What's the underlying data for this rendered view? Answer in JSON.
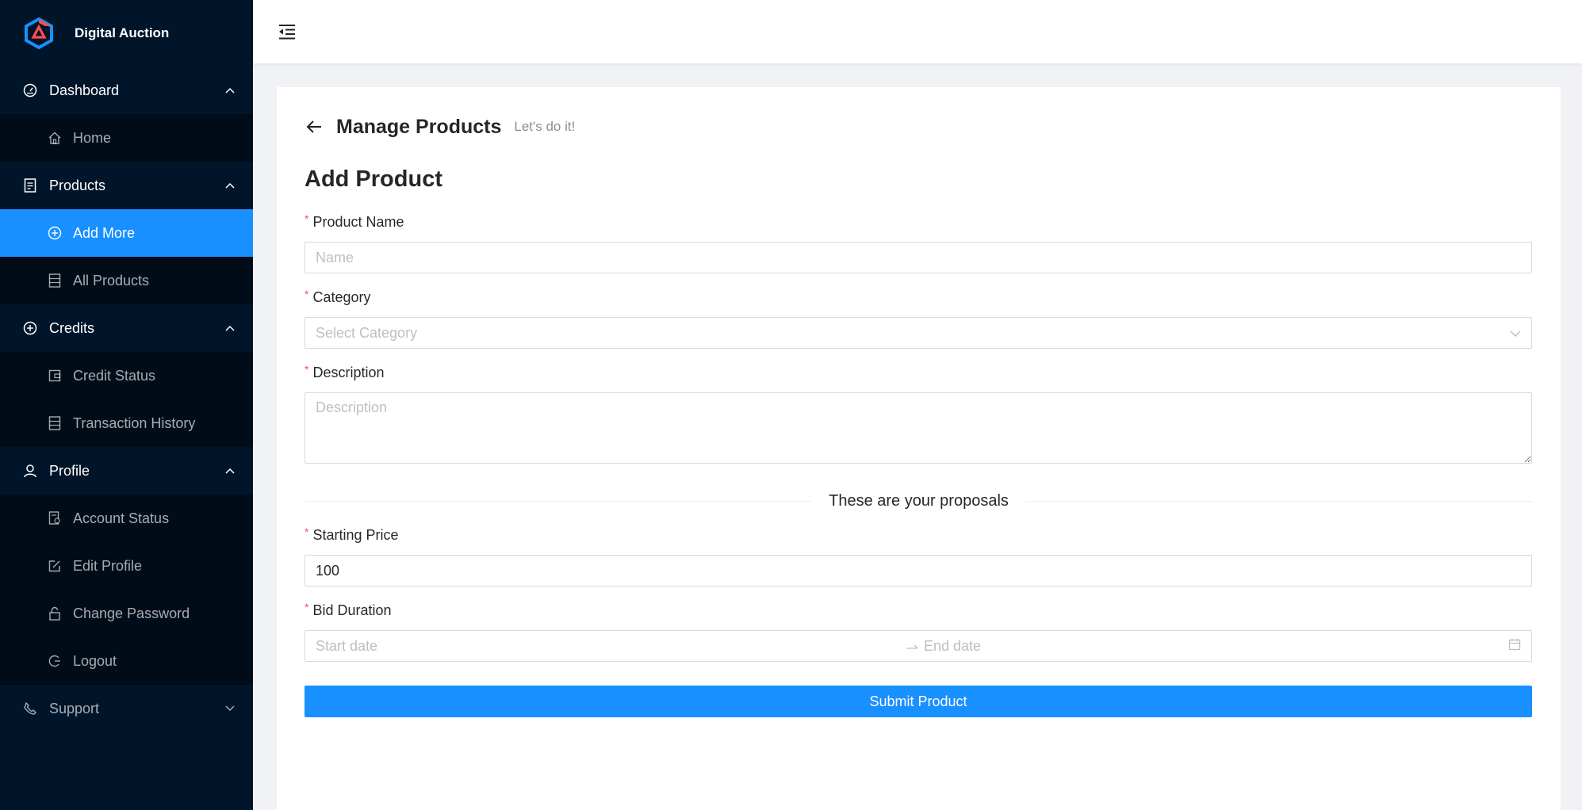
{
  "brand": {
    "title": "Digital Auction",
    "logo_icon": "hexagon-logo-icon"
  },
  "sidebar": {
    "groups": [
      {
        "label": "Dashboard",
        "icon": "dashboard-icon",
        "expanded": true,
        "items": [
          {
            "label": "Home",
            "icon": "home-icon"
          }
        ]
      },
      {
        "label": "Products",
        "icon": "file-icon",
        "expanded": true,
        "items": [
          {
            "label": "Add More",
            "icon": "plus-circle-icon",
            "active": true
          },
          {
            "label": "All Products",
            "icon": "list-icon"
          }
        ]
      },
      {
        "label": "Credits",
        "icon": "plus-circle-icon",
        "expanded": true,
        "items": [
          {
            "label": "Credit Status",
            "icon": "wallet-icon"
          },
          {
            "label": "Transaction History",
            "icon": "list-icon"
          }
        ]
      },
      {
        "label": "Profile",
        "icon": "user-icon",
        "expanded": true,
        "items": [
          {
            "label": "Account Status",
            "icon": "audit-icon"
          },
          {
            "label": "Edit Profile",
            "icon": "edit-icon"
          },
          {
            "label": "Change Password",
            "icon": "lock-icon"
          },
          {
            "label": "Logout",
            "icon": "logout-icon"
          }
        ]
      },
      {
        "label": "Support",
        "icon": "phone-icon",
        "expanded": false,
        "items": []
      }
    ]
  },
  "header": {
    "fold_icon": "menu-fold-icon"
  },
  "page": {
    "title": "Manage Products",
    "subtitle": "Let's do it!",
    "back_icon": "arrow-left-icon"
  },
  "form": {
    "title": "Add Product",
    "product_name": {
      "label": "Product Name",
      "placeholder": "Name",
      "value": ""
    },
    "category": {
      "label": "Category",
      "placeholder": "Select Category"
    },
    "description": {
      "label": "Description",
      "placeholder": "Description"
    },
    "divider_text": "These are your proposals",
    "starting_price": {
      "label": "Starting Price",
      "value": "100"
    },
    "bid_duration": {
      "label": "Bid Duration",
      "start_placeholder": "Start date",
      "end_placeholder": "End date"
    },
    "submit_label": "Submit Product"
  },
  "colors": {
    "sidebar_bg": "#001529",
    "submenu_bg": "#000c17",
    "primary": "#1890ff",
    "required": "#ff4d4f"
  }
}
